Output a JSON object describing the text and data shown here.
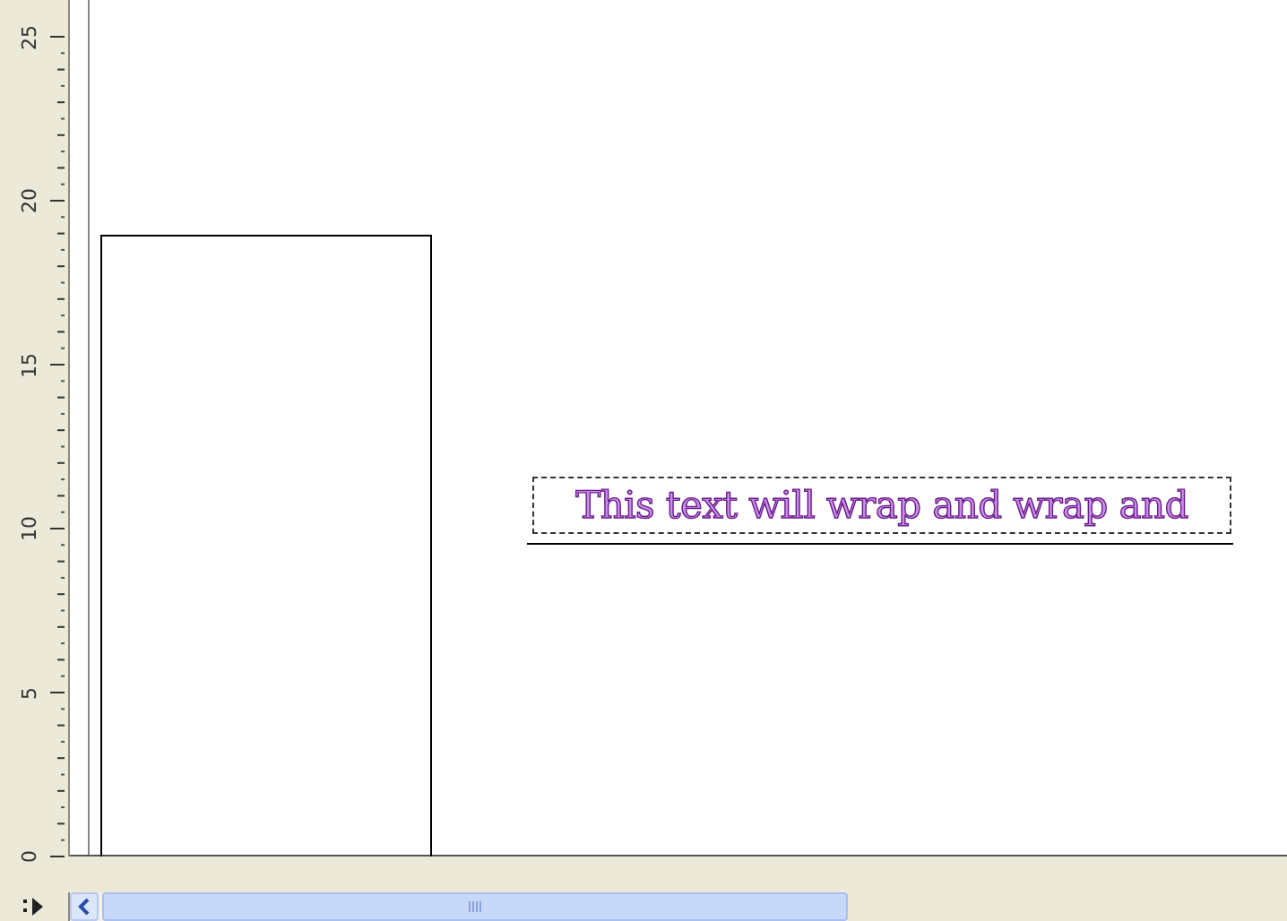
{
  "ruler": {
    "labels": [
      "0",
      "5",
      "10",
      "15",
      "20",
      "25"
    ]
  },
  "canvas": {
    "text_frame": {
      "text": "This text will wrap and wrap and"
    }
  }
}
